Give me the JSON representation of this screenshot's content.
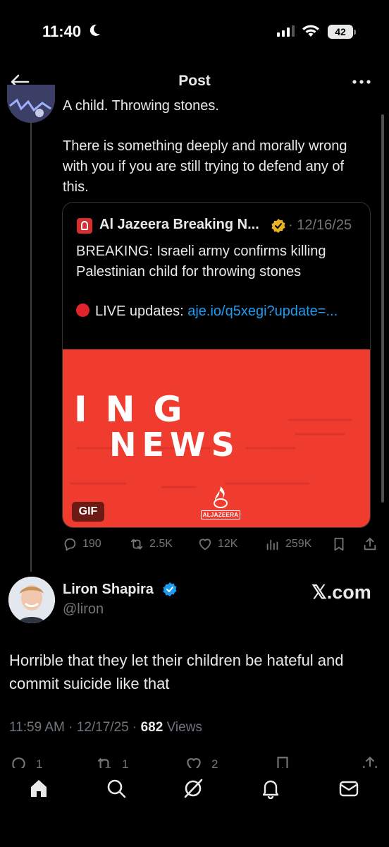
{
  "status": {
    "time": "11:40",
    "battery": "42"
  },
  "header": {
    "title": "Post"
  },
  "thread": {
    "cut_text": "A child. Throwing stones.",
    "text": "There is something deeply and morally wrong with you if you are still trying to defend any of this."
  },
  "quote": {
    "name": "Al Jazeera Breaking N...",
    "date": "· 12/16/25",
    "body": "BREAKING: Israeli army confirms killing Palestinian child for throwing stones",
    "live_prefix": "LIVE updates: ",
    "link": "aje.io/q5xegi?update=...",
    "media_line1": "ING",
    "media_line2": "NEWS",
    "media_brand": "ALJAZEERA",
    "gif_label": "GIF"
  },
  "actions": {
    "replies": "190",
    "reposts": "2.5K",
    "likes": "12K",
    "views": "259K"
  },
  "reply": {
    "name": "Liron Shapira",
    "handle": "@liron",
    "watermark": "𝕏.com",
    "text": "Horrible that they let their children be hateful and commit suicide like that",
    "meta_time": "11:59 AM · 12/17/25 · ",
    "views_count": "682",
    "views_label": " Views",
    "reply_count": "1",
    "repost_count": "1",
    "like_count": "2"
  },
  "colors": {
    "accent": "#1d9bf0",
    "media_red": "#f03c2e",
    "muted": "#71767b"
  }
}
